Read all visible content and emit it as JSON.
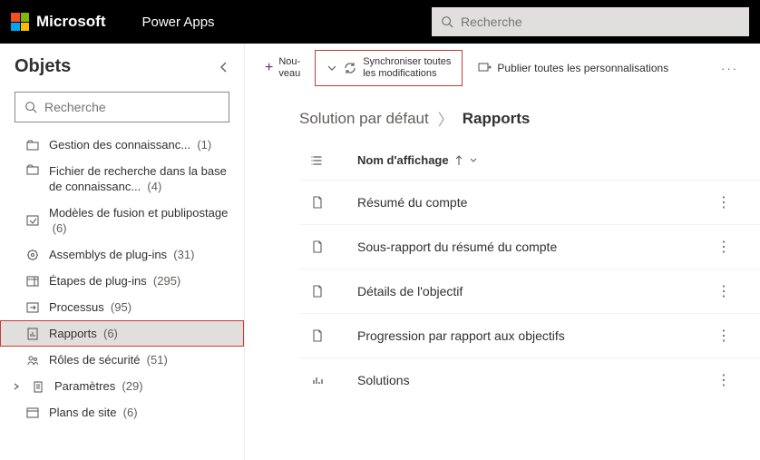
{
  "header": {
    "company": "Microsoft",
    "app": "Power Apps",
    "search_placeholder": "Recherche"
  },
  "sidebar": {
    "title": "Objets",
    "search_placeholder": "Recherche",
    "items": [
      {
        "icon": "folder",
        "label": "Gestion des connaissanc...",
        "count": "(1)"
      },
      {
        "icon": "folder",
        "label": "Fichier de recherche dans la base de connaissanc...",
        "count": "(4)",
        "multi": true
      },
      {
        "icon": "merge",
        "label": "Modèles de fusion et publipostage",
        "count": "(6)"
      },
      {
        "icon": "plugin",
        "label": "Assemblys de plug-ins",
        "count": "(31)"
      },
      {
        "icon": "steps",
        "label": "Étapes de plug-ins",
        "count": "(295)"
      },
      {
        "icon": "process",
        "label": "Processus",
        "count": "(95)"
      },
      {
        "icon": "report",
        "label": "Rapports",
        "count": "(6)",
        "active": true
      },
      {
        "icon": "roles",
        "label": "Rôles de sécurité",
        "count": "(51)"
      },
      {
        "icon": "settings",
        "label": "Paramètres",
        "count": "(29)",
        "expandable": true
      },
      {
        "icon": "sitemap",
        "label": "Plans de site",
        "count": "(6)"
      }
    ]
  },
  "commands": {
    "new": {
      "line1": "Nou-",
      "line2": "veau"
    },
    "sync": {
      "line1": "Synchroniser toutes",
      "line2": "les modifications"
    },
    "publish": "Publier toutes les personnalisations"
  },
  "breadcrumb": {
    "root": "Solution par défaut",
    "current": "Rapports"
  },
  "list": {
    "name_header": "Nom d'affichage",
    "rows": [
      {
        "icon": "doc",
        "name": "Résumé du compte"
      },
      {
        "icon": "doc",
        "name": "Sous-rapport du résumé du compte"
      },
      {
        "icon": "doc",
        "name": "Détails de l'objectif"
      },
      {
        "icon": "doc",
        "name": "Progression par rapport aux objectifs"
      },
      {
        "icon": "chart",
        "name": "Solutions"
      }
    ]
  }
}
